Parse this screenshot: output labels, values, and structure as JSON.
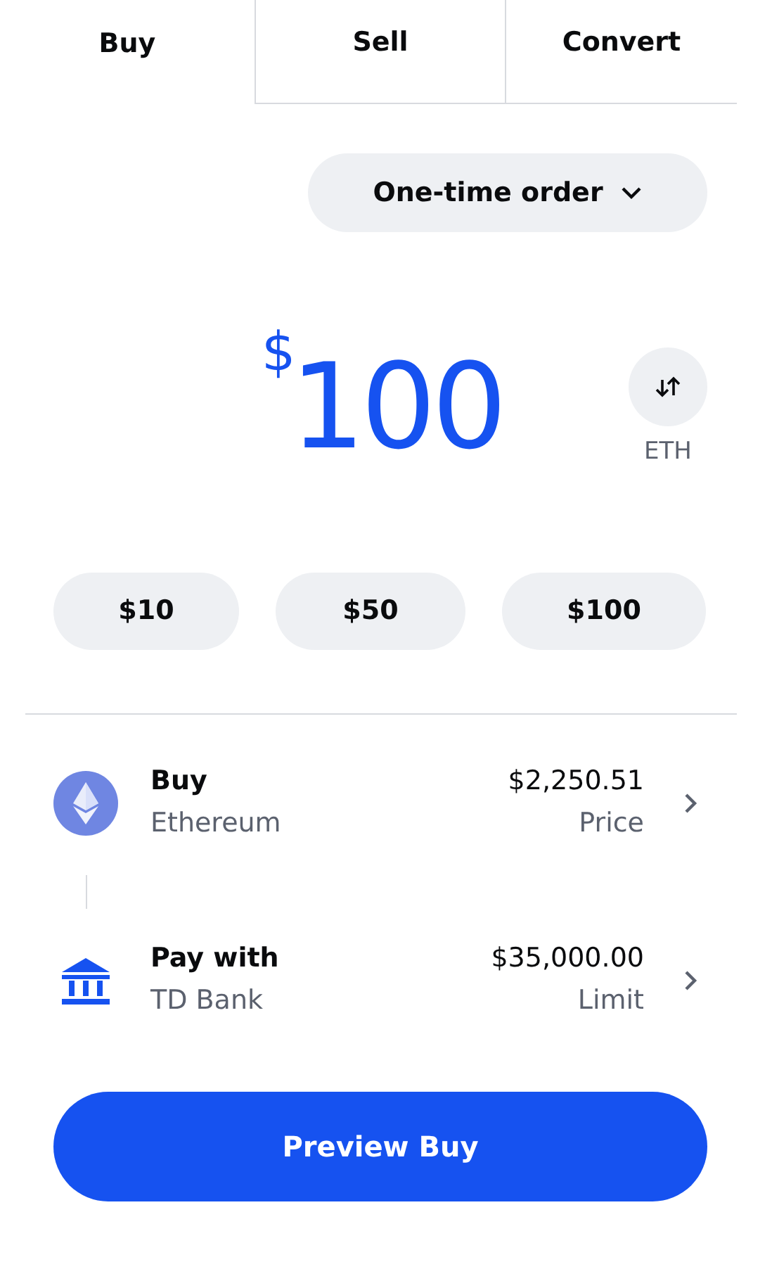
{
  "tabs": [
    {
      "label": "Buy",
      "selected": true
    },
    {
      "label": "Sell",
      "selected": false
    },
    {
      "label": "Convert",
      "selected": false
    }
  ],
  "order_type": {
    "label": "One-time order"
  },
  "amount": {
    "currency_symbol": "$",
    "value": "100",
    "unit_toggle": "ETH"
  },
  "presets": [
    "$10",
    "$50",
    "$100"
  ],
  "details": [
    {
      "kind": "asset",
      "title": "Buy",
      "subtitle": "Ethereum",
      "value": "$2,250.51",
      "value_label": "Price"
    },
    {
      "kind": "bank",
      "title": "Pay with",
      "subtitle": "TD Bank",
      "value": "$35,000.00",
      "value_label": "Limit"
    }
  ],
  "primary_button": {
    "label": "Preview Buy"
  }
}
